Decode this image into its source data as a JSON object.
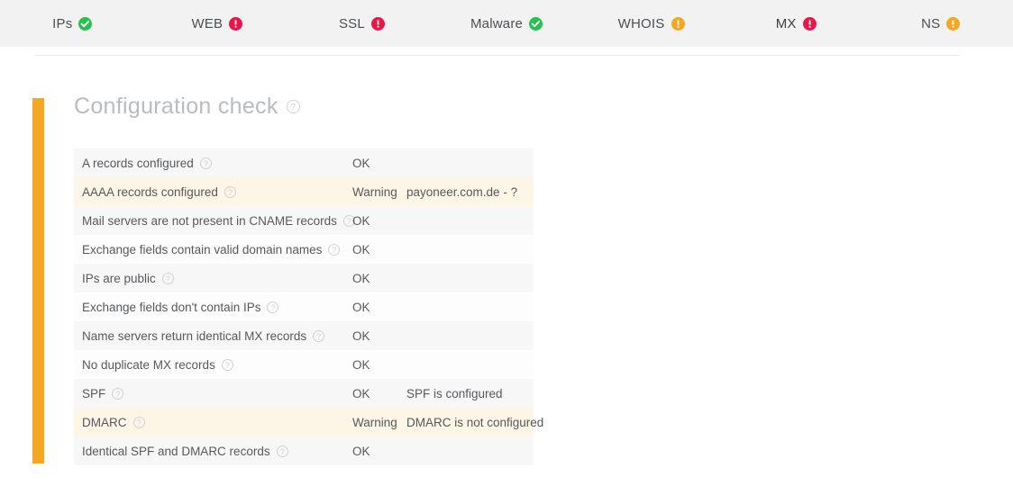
{
  "tabs": [
    {
      "label": "IPs",
      "status": "ok",
      "active": false
    },
    {
      "label": "WEB",
      "status": "error",
      "active": false
    },
    {
      "label": "SSL",
      "status": "error",
      "active": false
    },
    {
      "label": "Malware",
      "status": "ok",
      "active": false
    },
    {
      "label": "WHOIS",
      "status": "warning",
      "active": false
    },
    {
      "label": "MX",
      "status": "error",
      "active": true
    },
    {
      "label": "NS",
      "status": "warning",
      "active": false
    }
  ],
  "panel": {
    "title": "Configuration check",
    "help_glyph": "?"
  },
  "colors": {
    "ok": "#27c24c",
    "error": "#e8174a",
    "warning": "#f5a623",
    "accent_bar": "#f5a623",
    "tabbar_bg": "#f2f2f2",
    "warn_row_bg": "#fdf5e6"
  },
  "table": {
    "rows": [
      {
        "name": "A records configured",
        "status": "OK",
        "detail": "",
        "warn": false
      },
      {
        "name": "AAAA records configured",
        "status": "Warning",
        "detail": "payoneer.com.de - ?",
        "warn": true
      },
      {
        "name": "Mail servers are not present in CNAME records",
        "status": "OK",
        "detail": "",
        "warn": false
      },
      {
        "name": "Exchange fields contain valid domain names",
        "status": "OK",
        "detail": "",
        "warn": false
      },
      {
        "name": "IPs are public",
        "status": "OK",
        "detail": "",
        "warn": false
      },
      {
        "name": "Exchange fields don't contain IPs",
        "status": "OK",
        "detail": "",
        "warn": false
      },
      {
        "name": "Name servers return identical MX records",
        "status": "OK",
        "detail": "",
        "warn": false
      },
      {
        "name": "No duplicate MX records",
        "status": "OK",
        "detail": "",
        "warn": false
      },
      {
        "name": "SPF",
        "status": "OK",
        "detail": "SPF is configured",
        "warn": false
      },
      {
        "name": "DMARC",
        "status": "Warning",
        "detail": "DMARC is not configured",
        "warn": true
      },
      {
        "name": "Identical SPF and DMARC records",
        "status": "OK",
        "detail": "",
        "warn": false
      }
    ]
  }
}
